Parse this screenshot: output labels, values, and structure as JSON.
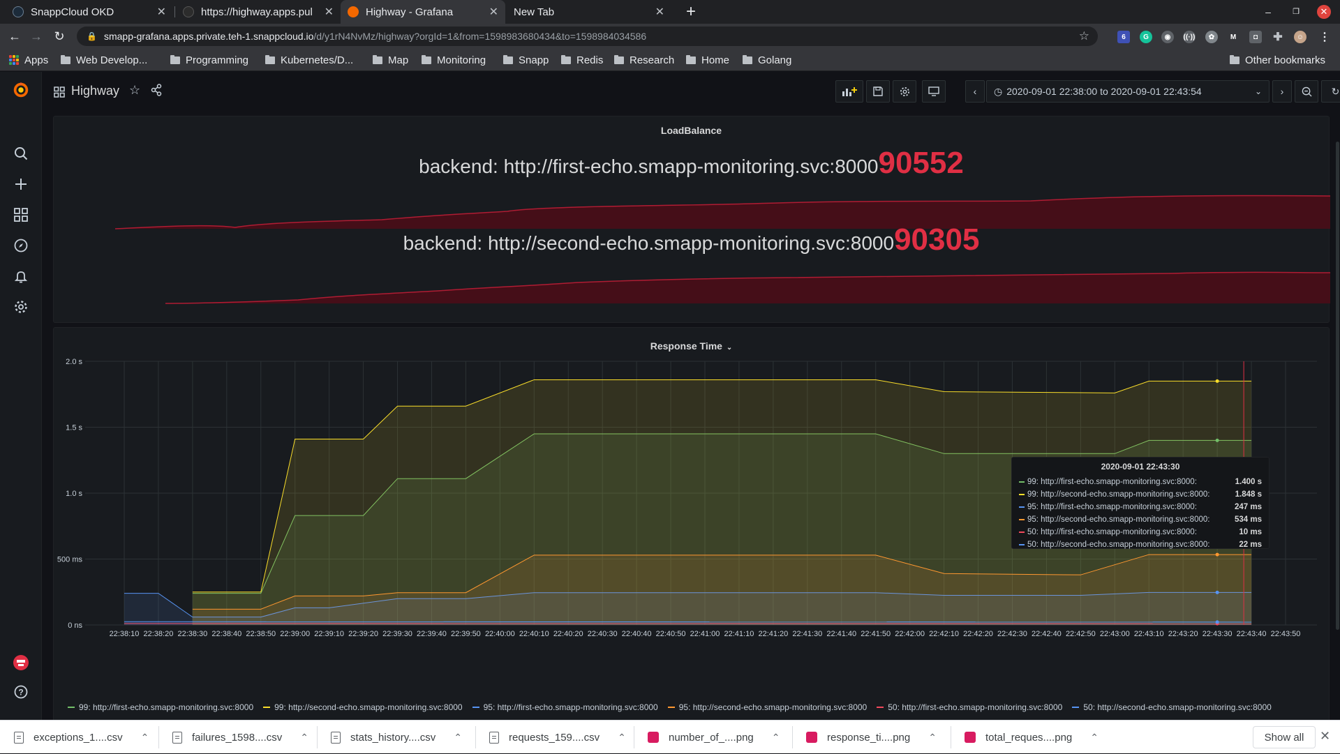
{
  "browser": {
    "tabs": [
      {
        "title": "SnappCloud OKD",
        "icon_color": "#1c2b3a"
      },
      {
        "title": "https://highway.apps.pul",
        "icon_color": "#2c2c2c"
      },
      {
        "title": "Highway - Grafana",
        "icon_color": "#f46800"
      },
      {
        "title": "New Tab",
        "icon_color": ""
      }
    ],
    "url_host": "smapp-grafana.apps.private.teh-1.snappcloud.io",
    "url_path": "/d/y1rN4NvMz/highway?orgId=1&from=1598983680434&to=1598984034586",
    "extension_badge": "6",
    "bookmarks": [
      "Apps",
      "Web Develop...",
      "Programming",
      "Kubernetes/D...",
      "Map",
      "Monitoring",
      "Snapp",
      "Redis",
      "Research",
      "Home",
      "Golang"
    ],
    "other_bookmarks": "Other bookmarks"
  },
  "grafana": {
    "dashboard_title": "Highway",
    "time_range": "2020-09-01 22:38:00 to 2020-09-01 22:43:54",
    "loadbalance_panel": {
      "title": "LoadBalance",
      "stats": [
        {
          "label": "backend: http://first-echo.smapp-monitoring.svc:8000",
          "value": "90552"
        },
        {
          "label": "backend: http://second-echo.smapp-monitoring.svc:8000",
          "value": "90305"
        }
      ]
    },
    "response_panel": {
      "title": "Response Time",
      "tooltip": {
        "time": "2020-09-01 22:43:30",
        "rows": [
          {
            "label": "99: http://first-echo.smapp-monitoring.svc:8000:",
            "value": "1.400 s"
          },
          {
            "label": "99: http://second-echo.smapp-monitoring.svc:8000:",
            "value": "1.848 s"
          },
          {
            "label": "95: http://first-echo.smapp-monitoring.svc:8000:",
            "value": "247 ms"
          },
          {
            "label": "95: http://second-echo.smapp-monitoring.svc:8000:",
            "value": "534 ms"
          },
          {
            "label": "50: http://first-echo.smapp-monitoring.svc:8000:",
            "value": "10 ms"
          },
          {
            "label": "50: http://second-echo.smapp-monitoring.svc:8000:",
            "value": "22 ms"
          }
        ]
      }
    }
  },
  "colors": {
    "accent_red": "#e02f44",
    "series": [
      "#73bf69",
      "#fade2a",
      "#5794f2",
      "#ff9830",
      "#f2495c",
      "#5794f2"
    ]
  },
  "chart_data": {
    "type": "area",
    "title": "Response Time",
    "ylim": [
      0,
      2.0
    ],
    "yticks": [
      "0 ns",
      "500 ms",
      "1.0 s",
      "1.5 s",
      "2.0 s"
    ],
    "x": [
      "22:38:10",
      "22:38:20",
      "22:38:30",
      "22:38:40",
      "22:38:50",
      "22:39:00",
      "22:39:10",
      "22:39:20",
      "22:39:30",
      "22:39:40",
      "22:39:50",
      "22:40:00",
      "22:40:10",
      "22:40:20",
      "22:40:30",
      "22:40:40",
      "22:40:50",
      "22:41:00",
      "22:41:10",
      "22:41:20",
      "22:41:30",
      "22:41:40",
      "22:41:50",
      "22:42:00",
      "22:42:10",
      "22:42:20",
      "22:42:30",
      "22:42:40",
      "22:42:50",
      "22:43:00",
      "22:43:10",
      "22:43:20",
      "22:43:30",
      "22:43:40",
      "22:43:50"
    ],
    "series": [
      {
        "name": "99: http://first-echo.smapp-monitoring.svc:8000",
        "color": "#73bf69",
        "points": [
          [
            "22:38:30",
            0.24
          ],
          [
            "22:38:50",
            0.24
          ],
          [
            "22:39:00",
            0.83
          ],
          [
            "22:39:20",
            0.83
          ],
          [
            "22:39:30",
            1.11
          ],
          [
            "22:39:50",
            1.11
          ],
          [
            "22:40:10",
            1.45
          ],
          [
            "22:41:50",
            1.45
          ],
          [
            "22:42:10",
            1.3
          ],
          [
            "22:43:00",
            1.3
          ],
          [
            "22:43:10",
            1.4
          ],
          [
            "22:43:40",
            1.4
          ]
        ]
      },
      {
        "name": "99: http://second-echo.smapp-monitoring.svc:8000",
        "color": "#fade2a",
        "points": [
          [
            "22:38:30",
            0.25
          ],
          [
            "22:38:50",
            0.25
          ],
          [
            "22:39:00",
            1.41
          ],
          [
            "22:39:20",
            1.41
          ],
          [
            "22:39:30",
            1.66
          ],
          [
            "22:39:50",
            1.66
          ],
          [
            "22:40:10",
            1.86
          ],
          [
            "22:41:50",
            1.86
          ],
          [
            "22:42:10",
            1.77
          ],
          [
            "22:43:00",
            1.76
          ],
          [
            "22:43:10",
            1.85
          ],
          [
            "22:43:40",
            1.85
          ]
        ]
      },
      {
        "name": "95: http://first-echo.smapp-monitoring.svc:8000",
        "color": "#5794f2",
        "points": [
          [
            "22:38:10",
            0.24
          ],
          [
            "22:38:20",
            0.24
          ],
          [
            "22:38:30",
            0.06
          ],
          [
            "22:38:50",
            0.06
          ],
          [
            "22:39:00",
            0.13
          ],
          [
            "22:39:10",
            0.13
          ],
          [
            "22:39:30",
            0.2
          ],
          [
            "22:39:50",
            0.2
          ],
          [
            "22:40:10",
            0.245
          ],
          [
            "22:41:50",
            0.245
          ],
          [
            "22:42:10",
            0.225
          ],
          [
            "22:42:50",
            0.225
          ],
          [
            "22:43:10",
            0.247
          ],
          [
            "22:43:40",
            0.247
          ]
        ]
      },
      {
        "name": "95: http://second-echo.smapp-monitoring.svc:8000",
        "color": "#ff9830",
        "points": [
          [
            "22:38:30",
            0.12
          ],
          [
            "22:38:50",
            0.12
          ],
          [
            "22:39:00",
            0.22
          ],
          [
            "22:39:20",
            0.22
          ],
          [
            "22:39:30",
            0.245
          ],
          [
            "22:39:50",
            0.245
          ],
          [
            "22:40:10",
            0.53
          ],
          [
            "22:41:50",
            0.53
          ],
          [
            "22:42:10",
            0.39
          ],
          [
            "22:42:50",
            0.38
          ],
          [
            "22:43:10",
            0.534
          ],
          [
            "22:43:40",
            0.534
          ]
        ]
      },
      {
        "name": "50: http://first-echo.smapp-monitoring.svc:8000",
        "color": "#f2495c",
        "points": [
          [
            "22:38:10",
            0.012
          ],
          [
            "22:43:40",
            0.01
          ]
        ]
      },
      {
        "name": "50: http://second-echo.smapp-monitoring.svc:8000",
        "color": "#5794f2",
        "points": [
          [
            "22:38:10",
            0.025
          ],
          [
            "22:43:40",
            0.022
          ]
        ]
      }
    ]
  },
  "downloads": [
    {
      "name": "exceptions_1....csv",
      "kind": "csv"
    },
    {
      "name": "failures_1598....csv",
      "kind": "csv"
    },
    {
      "name": "stats_history....csv",
      "kind": "csv"
    },
    {
      "name": "requests_159....csv",
      "kind": "csv"
    },
    {
      "name": "number_of_....png",
      "kind": "png"
    },
    {
      "name": "response_ti....png",
      "kind": "png"
    },
    {
      "name": "total_reques....png",
      "kind": "png"
    }
  ],
  "show_all": "Show all"
}
